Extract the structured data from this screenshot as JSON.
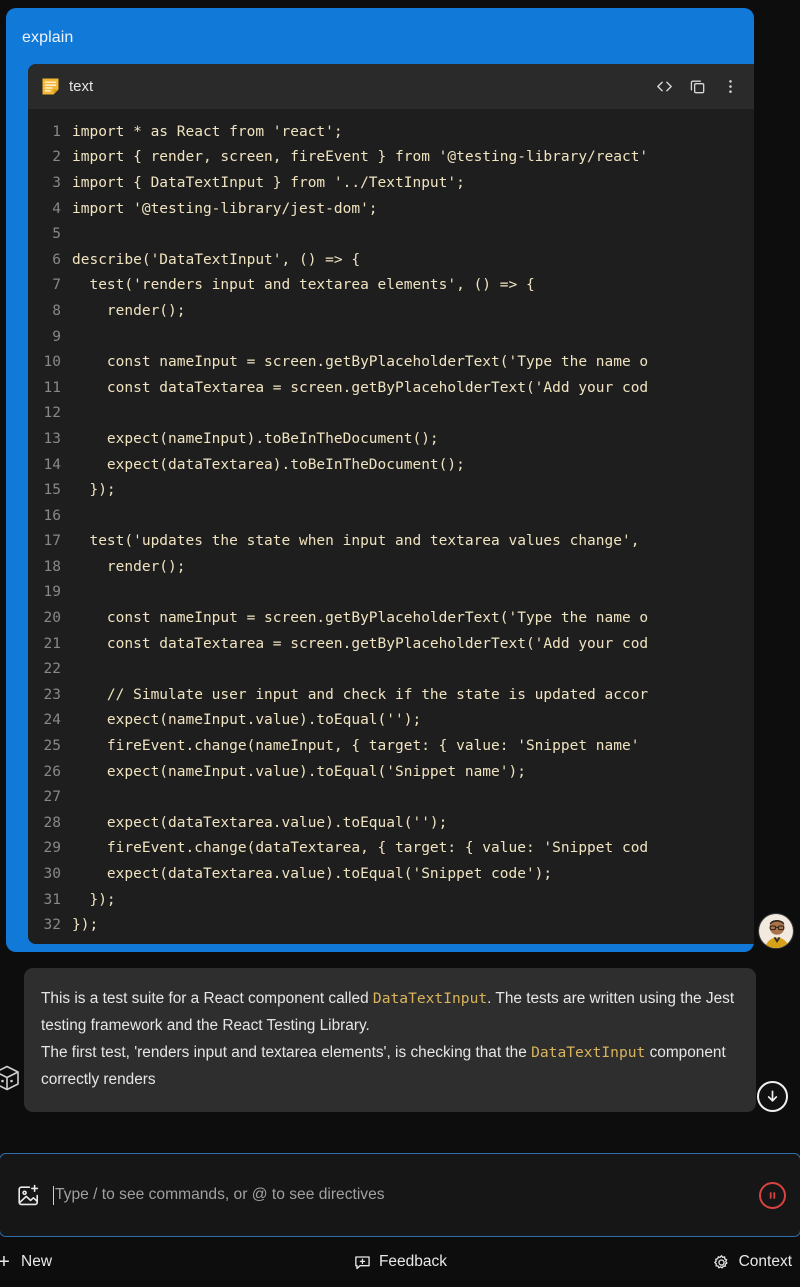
{
  "theme": {
    "background": "#0d0d0d",
    "accent_blue": "#1179d8",
    "code_bg": "#1e1e1e",
    "code_header_bg": "#2a2a2a",
    "code_text": "#f0e3c0",
    "line_number": "#888888",
    "bubble_bg": "#2e2e2e",
    "stop_red": "#d9433f",
    "composer_border": "#2f6ea8",
    "file_icon_yellow": "#f2b733"
  },
  "message": {
    "label": "explain"
  },
  "code_card": {
    "filename": "text",
    "file_icon": "note-document-icon",
    "actions": [
      {
        "name": "view-code-icon",
        "glyph": "code-brackets"
      },
      {
        "name": "copy-icon",
        "glyph": "copy-duplicate"
      },
      {
        "name": "more-options-icon",
        "glyph": "kebab-menu"
      }
    ],
    "language": "javascript",
    "lines": [
      {
        "n": "1",
        "text": "import * as React from 'react';"
      },
      {
        "n": "2",
        "text": "import { render, screen, fireEvent } from '@testing-library/react'"
      },
      {
        "n": "3",
        "text": "import { DataTextInput } from '../TextInput';"
      },
      {
        "n": "4",
        "text": "import '@testing-library/jest-dom';"
      },
      {
        "n": "5",
        "text": ""
      },
      {
        "n": "6",
        "text": "describe('DataTextInput', () => {"
      },
      {
        "n": "7",
        "text": "  test('renders input and textarea elements', () => {"
      },
      {
        "n": "8",
        "text": "    render();"
      },
      {
        "n": "9",
        "text": ""
      },
      {
        "n": "10",
        "text": "    const nameInput = screen.getByPlaceholderText('Type the name o"
      },
      {
        "n": "11",
        "text": "    const dataTextarea = screen.getByPlaceholderText('Add your cod"
      },
      {
        "n": "12",
        "text": ""
      },
      {
        "n": "13",
        "text": "    expect(nameInput).toBeInTheDocument();"
      },
      {
        "n": "14",
        "text": "    expect(dataTextarea).toBeInTheDocument();"
      },
      {
        "n": "15",
        "text": "  });"
      },
      {
        "n": "16",
        "text": ""
      },
      {
        "n": "17",
        "text": "  test('updates the state when input and textarea values change',"
      },
      {
        "n": "18",
        "text": "    render();"
      },
      {
        "n": "19",
        "text": ""
      },
      {
        "n": "20",
        "text": "    const nameInput = screen.getByPlaceholderText('Type the name o"
      },
      {
        "n": "21",
        "text": "    const dataTextarea = screen.getByPlaceholderText('Add your cod"
      },
      {
        "n": "22",
        "text": ""
      },
      {
        "n": "23",
        "text": "    // Simulate user input and check if the state is updated accor"
      },
      {
        "n": "24",
        "text": "    expect(nameInput.value).toEqual('');"
      },
      {
        "n": "25",
        "text": "    fireEvent.change(nameInput, { target: { value: 'Snippet name'"
      },
      {
        "n": "26",
        "text": "    expect(nameInput.value).toEqual('Snippet name');"
      },
      {
        "n": "27",
        "text": ""
      },
      {
        "n": "28",
        "text": "    expect(dataTextarea.value).toEqual('');"
      },
      {
        "n": "29",
        "text": "    fireEvent.change(dataTextarea, { target: { value: 'Snippet cod"
      },
      {
        "n": "30",
        "text": "    expect(dataTextarea.value).toEqual('Snippet code');"
      },
      {
        "n": "31",
        "text": "  });"
      },
      {
        "n": "32",
        "text": "});"
      }
    ]
  },
  "explanation": {
    "p1_before": "This is a test suite for a React component called ",
    "p1_code": "DataTextInput",
    "p1_after": ". The tests are written using the Jest testing framework and the React Testing Library.",
    "p2_before": "The first test, 'renders input and textarea elements', is checking that the ",
    "p2_code": "DataTextInput",
    "p2_after": " component correctly renders"
  },
  "overlays": {
    "cube_icon": "cube-icon",
    "scroll_down_icon": "scroll-to-bottom-icon",
    "avatar": "user-avatar"
  },
  "composer": {
    "attach_icon": "add-image-icon",
    "placeholder": "Type / to see commands, or @ to see directives",
    "value": "",
    "stop_icon": "pause-stop-icon"
  },
  "statusbar": {
    "new": {
      "icon": "plus-icon",
      "label": "New"
    },
    "feedback": {
      "icon": "feedback-bubble-icon",
      "label": "Feedback"
    },
    "context": {
      "icon": "gear-icon",
      "label": "Context"
    }
  }
}
